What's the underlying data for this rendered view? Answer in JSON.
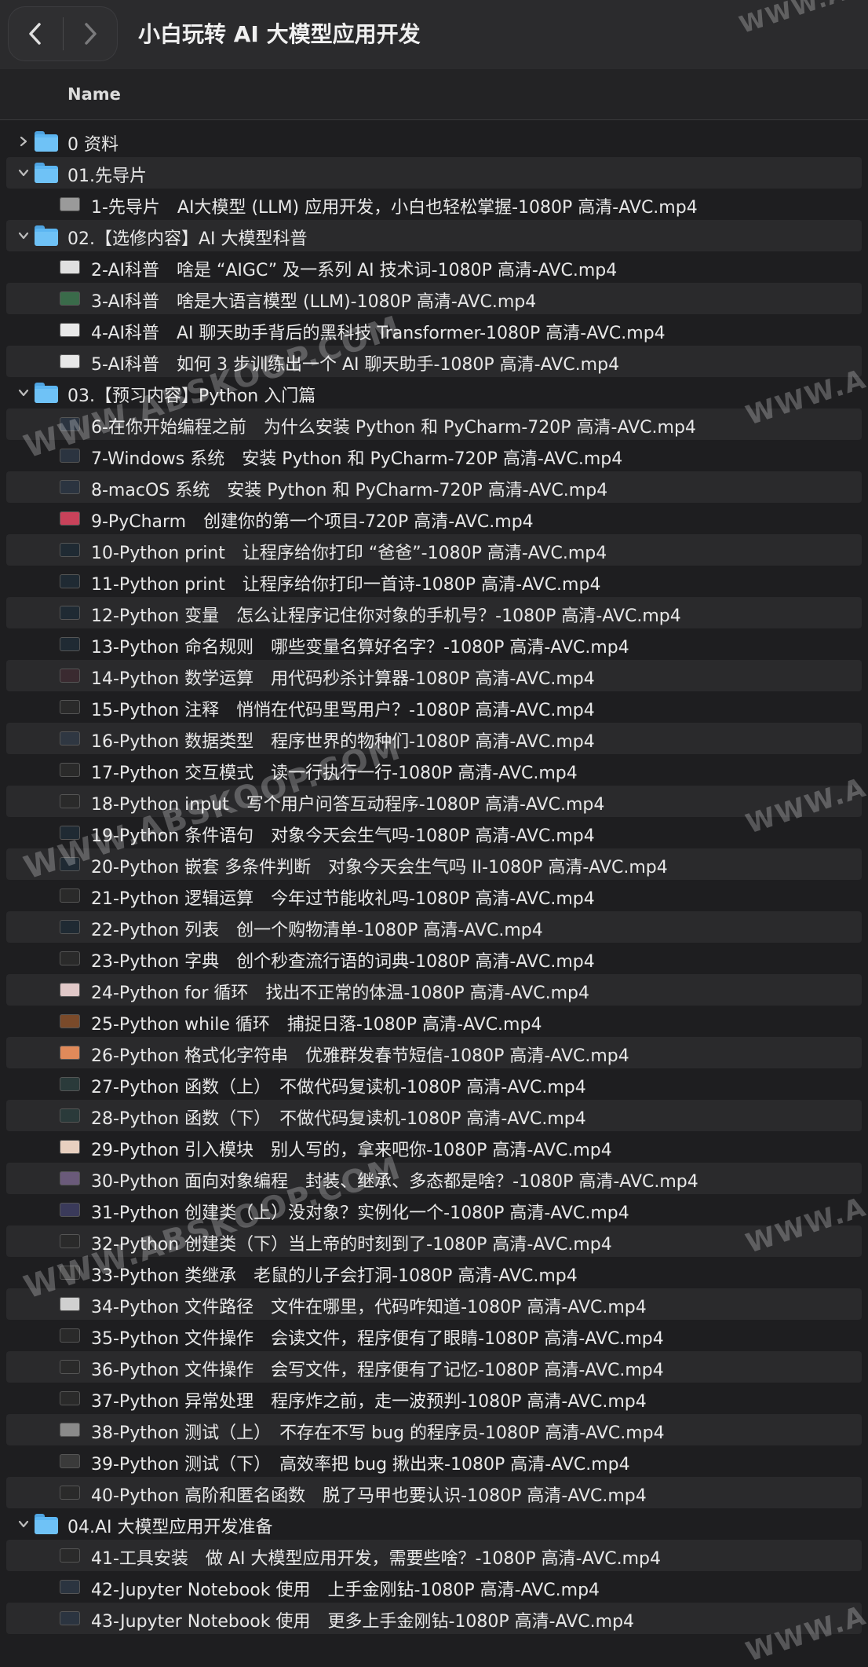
{
  "window": {
    "title": "小白玩转 AI 大模型应用开发"
  },
  "columns": {
    "name": "Name"
  },
  "watermarks": [
    "WWW.A",
    "WWW.A",
    "WWW.ABSKOOP.COM",
    "WWW.A",
    "WWW.ABSKOOP.COM",
    "WWW.A",
    "WWW.ABSKOOP.COM",
    "WWW.A"
  ],
  "rows": [
    {
      "kind": "folder",
      "expanded": false,
      "label": "0 资料"
    },
    {
      "kind": "folder",
      "expanded": true,
      "label": "01.先导片"
    },
    {
      "kind": "file",
      "thumb": "#9a9a9a",
      "label": "1-先导片　AI大模型 (LLM) 应用开发，小白也轻松掌握-1080P 高清-AVC.mp4"
    },
    {
      "kind": "folder",
      "expanded": true,
      "label": "02.【选修内容】AI 大模型科普"
    },
    {
      "kind": "file",
      "thumb": "#e0e0e0",
      "label": "2-AI科普　啥是 “AIGC” 及一系列 AI 技术词-1080P 高清-AVC.mp4"
    },
    {
      "kind": "file",
      "thumb": "#3a6b4a",
      "label": "3-AI科普　啥是大语言模型 (LLM)-1080P 高清-AVC.mp4"
    },
    {
      "kind": "file",
      "thumb": "#e8e8e8",
      "label": "4-AI科普　AI 聊天助手背后的黑科技 Transformer-1080P 高清-AVC.mp4"
    },
    {
      "kind": "file",
      "thumb": "#e8e8e8",
      "label": "5-AI科普　如何 3 步训练出一个 AI 聊天助手-1080P 高清-AVC.mp4"
    },
    {
      "kind": "folder",
      "expanded": true,
      "label": "03.【预习内容】Python 入门篇"
    },
    {
      "kind": "file",
      "thumb": "#2b3440",
      "label": "6-在你开始编程之前　为什么安装 Python 和 PyCharm-720P 高清-AVC.mp4"
    },
    {
      "kind": "file",
      "thumb": "#2b3440",
      "label": "7-Windows 系统　安装 Python 和 PyCharm-720P 高清-AVC.mp4"
    },
    {
      "kind": "file",
      "thumb": "#2b3440",
      "label": "8-macOS 系统　安装 Python 和 PyCharm-720P 高清-AVC.mp4"
    },
    {
      "kind": "file",
      "thumb": "#c8425a",
      "label": "9-PyCharm　创建你的第一个项目-720P 高清-AVC.mp4"
    },
    {
      "kind": "file",
      "thumb": "#1f2a33",
      "label": "10-Python print　让程序给你打印 “爸爸”-1080P 高清-AVC.mp4"
    },
    {
      "kind": "file",
      "thumb": "#1f2a33",
      "label": "11-Python print　让程序给你打印一首诗-1080P 高清-AVC.mp4"
    },
    {
      "kind": "file",
      "thumb": "#1f2a33",
      "label": "12-Python 变量　怎么让程序记住你对象的手机号？-1080P 高清-AVC.mp4"
    },
    {
      "kind": "file",
      "thumb": "#1f2a33",
      "label": "13-Python 命名规则　哪些变量名算好名字？-1080P 高清-AVC.mp4"
    },
    {
      "kind": "file",
      "thumb": "#3a2a30",
      "label": "14-Python 数学运算　用代码秒杀计算器-1080P 高清-AVC.mp4"
    },
    {
      "kind": "file",
      "thumb": "#2a2a2a",
      "label": "15-Python 注释　悄悄在代码里骂用户？-1080P 高清-AVC.mp4"
    },
    {
      "kind": "file",
      "thumb": "#2f3742",
      "label": "16-Python 数据类型　程序世界的物种们-1080P 高清-AVC.mp4"
    },
    {
      "kind": "file",
      "thumb": "#2a2a2a",
      "label": "17-Python 交互模式　读一行执行一行-1080P 高清-AVC.mp4"
    },
    {
      "kind": "file",
      "thumb": "#2a2a2a",
      "label": "18-Python input　写个用户问答互动程序-1080P 高清-AVC.mp4"
    },
    {
      "kind": "file",
      "thumb": "#1f2a33",
      "label": "19-Python 条件语句　对象今天会生气吗-1080P 高清-AVC.mp4"
    },
    {
      "kind": "file",
      "thumb": "#1f2a33",
      "label": "20-Python 嵌套 多条件判断　对象今天会生气吗 II-1080P 高清-AVC.mp4"
    },
    {
      "kind": "file",
      "thumb": "#2a2a2a",
      "label": "21-Python 逻辑运算　今年过节能收礼吗-1080P 高清-AVC.mp4"
    },
    {
      "kind": "file",
      "thumb": "#1f2a33",
      "label": "22-Python 列表　创一个购物清单-1080P 高清-AVC.mp4"
    },
    {
      "kind": "file",
      "thumb": "#2a2a2a",
      "label": "23-Python 字典　创个秒查流行语的词典-1080P 高清-AVC.mp4"
    },
    {
      "kind": "file",
      "thumb": "#e0c8c8",
      "label": "24-Python for 循环　找出不正常的体温-1080P 高清-AVC.mp4"
    },
    {
      "kind": "file",
      "thumb": "#7a4a2a",
      "label": "25-Python while 循环　捕捉日落-1080P 高清-AVC.mp4"
    },
    {
      "kind": "file",
      "thumb": "#e08a5a",
      "label": "26-Python 格式化字符串　优雅群发春节短信-1080P 高清-AVC.mp4"
    },
    {
      "kind": "file",
      "thumb": "#2a3a3a",
      "label": "27-Python 函数（上）　不做代码复读机-1080P 高清-AVC.mp4"
    },
    {
      "kind": "file",
      "thumb": "#2a3a3a",
      "label": "28-Python 函数（下）　不做代码复读机-1080P 高清-AVC.mp4"
    },
    {
      "kind": "file",
      "thumb": "#e8d0c0",
      "label": "29-Python 引入模块　别人写的，拿来吧你-1080P 高清-AVC.mp4"
    },
    {
      "kind": "file",
      "thumb": "#6a5a7a",
      "label": "30-Python 面向对象编程　封装、继承、多态都是啥？-1080P 高清-AVC.mp4"
    },
    {
      "kind": "file",
      "thumb": "#3a3a5a",
      "label": "31-Python 创建类（上）没对象？实例化一个-1080P 高清-AVC.mp4"
    },
    {
      "kind": "file",
      "thumb": "#2a2a2a",
      "label": "32-Python 创建类（下）当上帝的时刻到了-1080P 高清-AVC.mp4"
    },
    {
      "kind": "file",
      "thumb": "#2a2a2a",
      "label": "33-Python 类继承　老鼠的儿子会打洞-1080P 高清-AVC.mp4"
    },
    {
      "kind": "file",
      "thumb": "#d0d0d0",
      "label": "34-Python 文件路径　文件在哪里，代码咋知道-1080P 高清-AVC.mp4"
    },
    {
      "kind": "file",
      "thumb": "#2a2a2a",
      "label": "35-Python 文件操作　会读文件，程序便有了眼睛-1080P 高清-AVC.mp4"
    },
    {
      "kind": "file",
      "thumb": "#2a2a2a",
      "label": "36-Python 文件操作　会写文件，程序便有了记忆-1080P 高清-AVC.mp4"
    },
    {
      "kind": "file",
      "thumb": "#2a2a2a",
      "label": "37-Python 异常处理　程序炸之前，走一波预判-1080P 高清-AVC.mp4"
    },
    {
      "kind": "file",
      "thumb": "#8a8a8a",
      "label": "38-Python 测试（上）　不存在不写 bug 的程序员-1080P 高清-AVC.mp4"
    },
    {
      "kind": "file",
      "thumb": "#3a3a3a",
      "label": "39-Python 测试（下）　高效率把 bug 揪出来-1080P 高清-AVC.mp4"
    },
    {
      "kind": "file",
      "thumb": "#2a2a2a",
      "label": "40-Python 高阶和匿名函数　脱了马甲也要认识-1080P 高清-AVC.mp4"
    },
    {
      "kind": "folder",
      "expanded": true,
      "label": "04.AI 大模型应用开发准备"
    },
    {
      "kind": "file",
      "thumb": "#2a2a2a",
      "label": "41-工具安装　做 AI 大模型应用开发，需要些啥？-1080P 高清-AVC.mp4"
    },
    {
      "kind": "file",
      "thumb": "#2b3440",
      "label": "42-Jupyter Notebook 使用　上手金刚钻-1080P 高清-AVC.mp4"
    },
    {
      "kind": "file",
      "thumb": "#2b3440",
      "label": "43-Jupyter Notebook 使用　更多上手金刚钻-1080P 高清-AVC.mp4"
    }
  ]
}
